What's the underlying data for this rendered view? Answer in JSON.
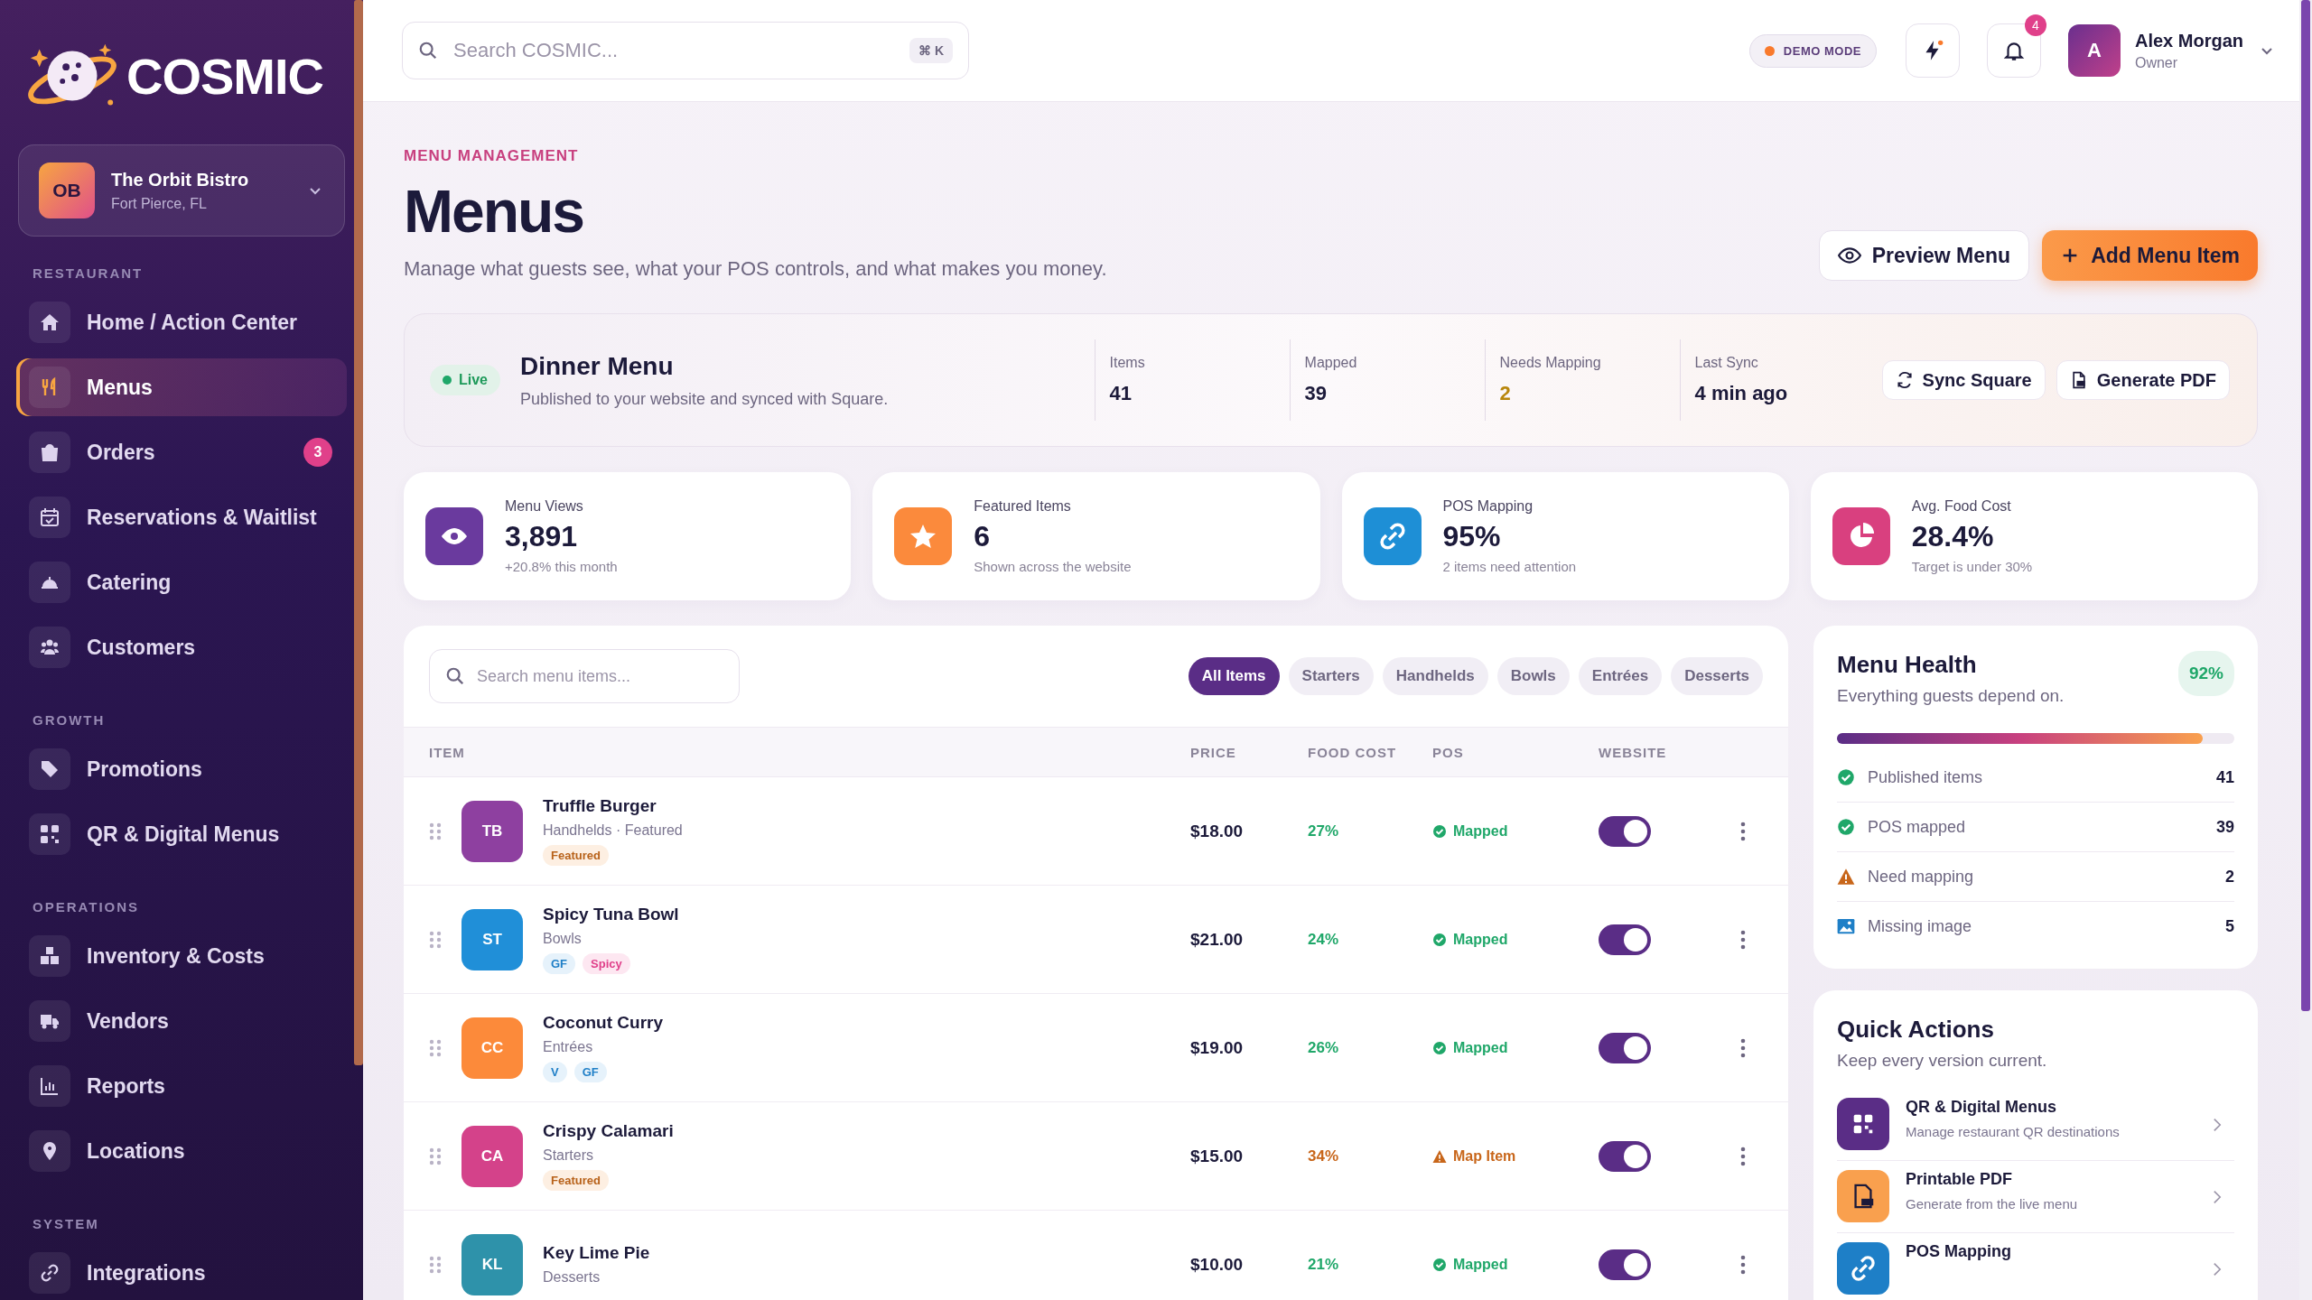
{
  "brand": {
    "name": "COSMIC"
  },
  "restaurant": {
    "initials": "OB",
    "name": "The Orbit Bistro",
    "location": "Fort Pierce, FL"
  },
  "nav_sections": [
    {
      "label": "RESTAURANT",
      "items": [
        {
          "label": "Home / Action Center",
          "selected": false
        },
        {
          "label": "Menus",
          "selected": true
        },
        {
          "label": "Orders",
          "selected": false,
          "badge": "3"
        },
        {
          "label": "Reservations & Waitlist",
          "selected": false
        },
        {
          "label": "Catering",
          "selected": false
        },
        {
          "label": "Customers",
          "selected": false
        }
      ]
    },
    {
      "label": "GROWTH",
      "items": [
        {
          "label": "Promotions",
          "selected": false
        },
        {
          "label": "QR & Digital Menus",
          "selected": false
        }
      ]
    },
    {
      "label": "OPERATIONS",
      "items": [
        {
          "label": "Inventory & Costs",
          "selected": false
        },
        {
          "label": "Vendors",
          "selected": false
        },
        {
          "label": "Reports",
          "selected": false
        },
        {
          "label": "Locations",
          "selected": false
        }
      ]
    },
    {
      "label": "SYSTEM",
      "items": [
        {
          "label": "Integrations",
          "selected": false
        }
      ]
    }
  ],
  "topbar": {
    "search": {
      "placeholder": "Search COSMIC...",
      "shortcut": "⌘ K"
    },
    "demo_badge": "DEMO MODE",
    "notifications": "4",
    "user": {
      "initial": "A",
      "name": "Alex Morgan",
      "role": "Owner"
    }
  },
  "header": {
    "eyebrow": "MENU MANAGEMENT",
    "title": "Menus",
    "subtitle": "Manage what guests see, what your POS controls, and what makes you money.",
    "buttons": [
      "Preview Menu",
      "Add Menu Item"
    ]
  },
  "menu_card": {
    "status": "Live",
    "name": "Dinner Menu",
    "description": "Published to your website and synced with Square.",
    "stats": [
      {
        "label": "Items",
        "value": "41",
        "kind": "plain"
      },
      {
        "label": "Mapped",
        "value": "39",
        "kind": "plain"
      },
      {
        "label": "Needs Mapping",
        "value": "2",
        "kind": "alert"
      },
      {
        "label": "Last Sync",
        "value": "4 min ago",
        "kind": "plain"
      }
    ],
    "actions": [
      "Sync Square",
      "Generate PDF"
    ]
  },
  "stat_cards": [
    {
      "label": "Menu Views",
      "value": "3,891",
      "note": "+20.8% this month",
      "color": "#6a3a9e"
    },
    {
      "label": "Featured Items",
      "value": "6",
      "note": "Shown across the website",
      "color": "#fb8a3c"
    },
    {
      "label": "POS Mapping",
      "value": "95%",
      "note": "2 items need attention",
      "color": "#1e8fd6"
    },
    {
      "label": "Avg. Food Cost",
      "value": "28.4%",
      "note": "Target is under 30%",
      "color": "#d9407f"
    }
  ],
  "filters": [
    {
      "label": "All Items",
      "selected": true
    },
    {
      "label": "Starters",
      "selected": false
    },
    {
      "label": "Handhelds",
      "selected": false
    },
    {
      "label": "Bowls",
      "selected": false
    },
    {
      "label": "Entrées",
      "selected": false
    },
    {
      "label": "Desserts",
      "selected": false
    }
  ],
  "table": {
    "search_placeholder": "Search menu items...",
    "columns": [
      "ITEM",
      "PRICE",
      "FOOD COST",
      "POS",
      "WEBSITE"
    ],
    "rows": [
      {
        "initials": "TB",
        "color": "#8e40a0",
        "name": "Truffle Burger",
        "meta": "Handhelds · Featured",
        "tags": [
          {
            "label": "Featured",
            "kind": "featured"
          }
        ],
        "price": "$18.00",
        "food_cost": "27%",
        "cost_alert": false,
        "pos": {
          "label": "Mapped",
          "kind": "ok"
        },
        "website_on": true
      },
      {
        "initials": "ST",
        "color": "#208fd8",
        "name": "Spicy Tuna Bowl",
        "meta": "Bowls",
        "tags": [
          {
            "label": "GF",
            "kind": "diet"
          },
          {
            "label": "Spicy",
            "kind": "spicy"
          }
        ],
        "price": "$21.00",
        "food_cost": "24%",
        "cost_alert": false,
        "pos": {
          "label": "Mapped",
          "kind": "ok"
        },
        "website_on": true
      },
      {
        "initials": "CC",
        "color": "#fc8a3a",
        "name": "Coconut Curry",
        "meta": "Entrées",
        "tags": [
          {
            "label": "V",
            "kind": "diet"
          },
          {
            "label": "GF",
            "kind": "diet"
          }
        ],
        "price": "$19.00",
        "food_cost": "26%",
        "cost_alert": false,
        "pos": {
          "label": "Mapped",
          "kind": "ok"
        },
        "website_on": true
      },
      {
        "initials": "CA",
        "color": "#d4428a",
        "name": "Crispy Calamari",
        "meta": "Starters",
        "tags": [
          {
            "label": "Featured",
            "kind": "featured"
          }
        ],
        "price": "$15.00",
        "food_cost": "34%",
        "cost_alert": true,
        "pos": {
          "label": "Map Item",
          "kind": "warn"
        },
        "website_on": true
      },
      {
        "initials": "KL",
        "color": "#2e92aa",
        "name": "Key Lime Pie",
        "meta": "Desserts",
        "tags": [],
        "price": "$10.00",
        "food_cost": "21%",
        "cost_alert": false,
        "pos": {
          "label": "Mapped",
          "kind": "ok"
        },
        "website_on": true
      }
    ]
  },
  "health": {
    "title": "Menu Health",
    "subtitle": "Everything guests depend on.",
    "score": "92%",
    "level": 0.92,
    "items": [
      {
        "kind": "ok",
        "label": "Published items",
        "value": "41"
      },
      {
        "kind": "ok",
        "label": "POS mapped",
        "value": "39"
      },
      {
        "kind": "warn",
        "label": "Need mapping",
        "value": "2"
      },
      {
        "kind": "image",
        "label": "Missing image",
        "value": "5"
      }
    ]
  },
  "quick_actions": {
    "title": "Quick Actions",
    "subtitle": "Keep every version current.",
    "items": [
      {
        "kind": "qr",
        "title": "QR & Digital Menus",
        "description": "Manage restaurant QR destinations",
        "color": "#5a2d86"
      },
      {
        "kind": "pdf",
        "title": "Printable PDF",
        "description": "Generate from the live menu",
        "color": "#f9a04e"
      },
      {
        "kind": "link",
        "title": "POS Mapping",
        "color": "#1e7fc7"
      }
    ]
  }
}
